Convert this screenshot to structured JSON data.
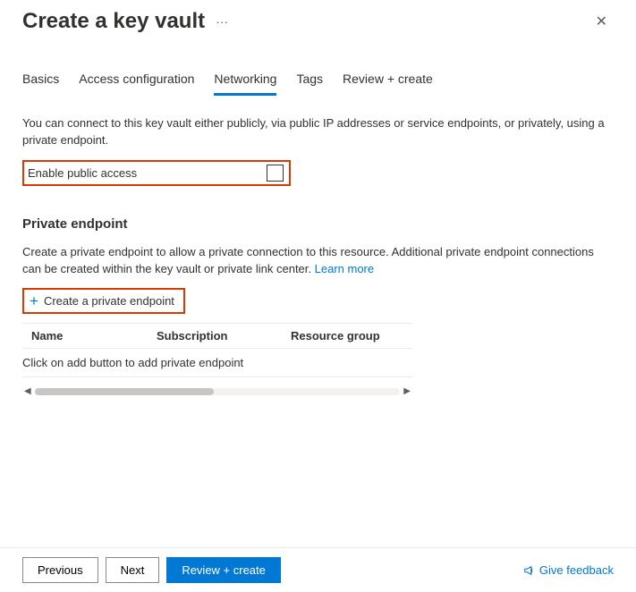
{
  "header": {
    "title": "Create a key vault",
    "more_glyph": "···",
    "close_glyph": "✕"
  },
  "tabs": {
    "items": [
      {
        "label": "Basics"
      },
      {
        "label": "Access configuration"
      },
      {
        "label": "Networking"
      },
      {
        "label": "Tags"
      },
      {
        "label": "Review + create"
      }
    ]
  },
  "networking": {
    "intro": "You can connect to this key vault either publicly, via public IP addresses or service endpoints, or privately, using a private endpoint.",
    "enable_public_label": "Enable public access",
    "private_endpoint": {
      "heading": "Private endpoint",
      "desc": "Create a private endpoint to allow a private connection to this resource. Additional private endpoint connections can be created within the key vault or private link center.  ",
      "learn_more": "Learn more",
      "create_label": "Create a private endpoint",
      "table": {
        "headers": {
          "name": "Name",
          "subscription": "Subscription",
          "resource_group": "Resource group"
        },
        "empty": "Click on add button to add private endpoint"
      }
    }
  },
  "footer": {
    "previous": "Previous",
    "next": "Next",
    "review": "Review + create",
    "feedback": "Give feedback"
  },
  "icons": {
    "plus": "+"
  },
  "scroll": {
    "left": "◀",
    "right": "▶"
  }
}
